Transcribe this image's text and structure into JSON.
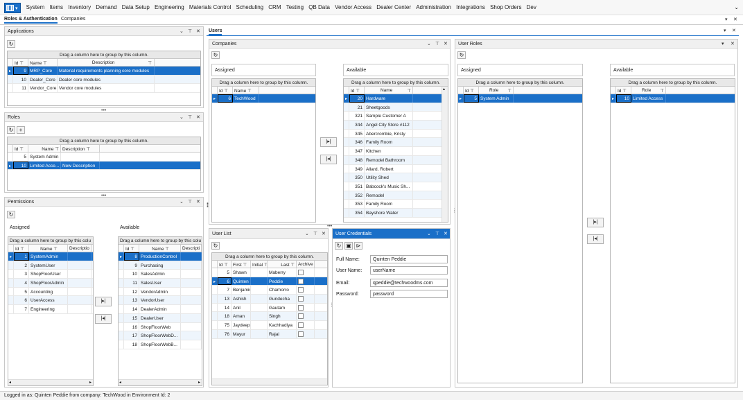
{
  "menu": [
    "System",
    "Items",
    "Inventory",
    "Demand",
    "Data Setup",
    "Engineering",
    "Materials Control",
    "Scheduling",
    "CRM",
    "Testing",
    "QB Data",
    "Vendor Access",
    "Dealer Center",
    "Administration",
    "Integrations",
    "Shop Orders",
    "Dev"
  ],
  "tabs": {
    "roles_auth": "Roles & Authentication",
    "companies": "Companies"
  },
  "common": {
    "group_hint": "Drag a column here to group by this column.",
    "group_hint_short": "Drag a column here to group by this colu",
    "assigned": "Assigned",
    "available": "Available",
    "move_right": "|▸|",
    "move_left": "|◂|"
  },
  "applications": {
    "title": "Applications",
    "cols": [
      "Id",
      "Name",
      "Description"
    ],
    "rows": [
      [
        "9",
        "MRP_Core",
        "Material requirements planning core modules"
      ],
      [
        "10",
        "Dealer_Core",
        "Dealer core modules"
      ],
      [
        "11",
        "Vendor_Core",
        "Vendor core modules"
      ]
    ]
  },
  "roles": {
    "title": "Roles",
    "cols": [
      "Id",
      "Name",
      "Description"
    ],
    "rows": [
      [
        "5",
        "System Admin",
        ""
      ],
      [
        "10",
        "Limited Acce...",
        "New Description"
      ]
    ]
  },
  "permissions": {
    "title": "Permissions",
    "assigned_cols": [
      "Id",
      "Name",
      "Descriptio"
    ],
    "assigned": [
      [
        "1",
        "SystemAdmin"
      ],
      [
        "2",
        "SystemUser"
      ],
      [
        "3",
        "ShopFloorUser"
      ],
      [
        "4",
        "ShopFloorAdmin"
      ],
      [
        "5",
        "Accounting"
      ],
      [
        "6",
        "UserAccess"
      ],
      [
        "7",
        "Engineering"
      ]
    ],
    "available_cols": [
      "Id",
      "Name",
      "Descripti"
    ],
    "available": [
      [
        "8",
        "ProductionControl"
      ],
      [
        "9",
        "Purchasing"
      ],
      [
        "10",
        "SalesAdmin"
      ],
      [
        "11",
        "SalesUser"
      ],
      [
        "12",
        "VendorAdmin"
      ],
      [
        "13",
        "VendorUser"
      ],
      [
        "14",
        "DealerAdmin"
      ],
      [
        "15",
        "DealerUser"
      ],
      [
        "16",
        "ShopFloorWeb"
      ],
      [
        "17",
        "ShopFloorWebD..."
      ],
      [
        "18",
        "ShopFloorWebB..."
      ]
    ]
  },
  "users": {
    "tab": "Users"
  },
  "companies": {
    "title": "Companies",
    "cols": [
      "Id",
      "Name"
    ],
    "assigned": [
      [
        "6",
        "TechWood"
      ]
    ],
    "available": [
      [
        "20",
        "Hardware"
      ],
      [
        "21",
        "Sheetgoods"
      ],
      [
        "321",
        "Sample Customer A"
      ],
      [
        "344",
        "Angel City Store #112"
      ],
      [
        "345",
        "Abercrombie, Kristy"
      ],
      [
        "346",
        "Family Room"
      ],
      [
        "347",
        "Kitchen"
      ],
      [
        "348",
        "Remodel Bathroom"
      ],
      [
        "349",
        "Allard, Robert"
      ],
      [
        "350",
        "Utility Shed"
      ],
      [
        "351",
        "Babcock's Music Sh..."
      ],
      [
        "352",
        "Remodel"
      ],
      [
        "353",
        "Family Room"
      ],
      [
        "354",
        "Bayshore Water"
      ]
    ]
  },
  "user_list": {
    "title": "User List",
    "cols": [
      "Id",
      "First",
      "Initial",
      "Last",
      "Archive"
    ],
    "rows": [
      [
        "5",
        "Shawn",
        "",
        "Maberry"
      ],
      [
        "6",
        "Quinten",
        "",
        "Peddie"
      ],
      [
        "7",
        "Benjamin",
        "",
        "Chamorro"
      ],
      [
        "13",
        "Ashish",
        "",
        "Gundecha"
      ],
      [
        "14",
        "Anil",
        "",
        "Gautam"
      ],
      [
        "18",
        "Aman",
        "",
        "Singh"
      ],
      [
        "75",
        "Jaydeep",
        "",
        "Kachhadiya"
      ],
      [
        "76",
        "Mayur",
        "",
        "Rajai"
      ]
    ]
  },
  "credentials": {
    "title": "User Credentials",
    "full_name_label": "Full Name:",
    "full_name": "Quinten Peddie",
    "user_name_label": "User Name:",
    "user_name": "userName",
    "email_label": "Email:",
    "email": "qpeddie@techwoodms.com",
    "password_label": "Password:",
    "password": "password"
  },
  "user_roles": {
    "title": "User Roles",
    "cols": [
      "Id",
      "Role"
    ],
    "assigned": [
      [
        "5",
        "System Admin"
      ]
    ],
    "available": [
      [
        "10",
        "Limited Access"
      ]
    ]
  },
  "status": "Logged in as: Quinten Peddie  from company: TechWood in Environment Id: 2",
  "colors": {
    "accent": "#1a6fc8"
  }
}
